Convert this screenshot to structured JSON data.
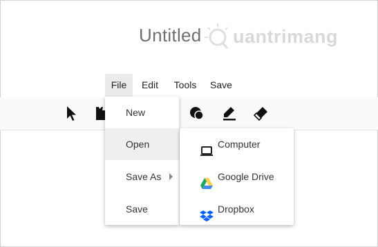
{
  "document": {
    "title": "Untitled"
  },
  "watermark": {
    "text": "uantrimang"
  },
  "menubar": {
    "items": [
      {
        "label": "File"
      },
      {
        "label": "Edit"
      },
      {
        "label": "Tools"
      },
      {
        "label": "Save"
      }
    ]
  },
  "toolbar": {
    "tools": [
      {
        "icon": "cursor-icon"
      },
      {
        "icon": "clapper-icon"
      },
      {
        "icon": "shape-fill-icon"
      },
      {
        "icon": "pen-icon"
      },
      {
        "icon": "eraser-icon"
      }
    ]
  },
  "file_menu": {
    "items": [
      {
        "label": "New"
      },
      {
        "label": "Open"
      },
      {
        "label": "Save As"
      },
      {
        "label": "Save"
      }
    ]
  },
  "open_submenu": {
    "items": [
      {
        "label": "Computer",
        "icon": "laptop-icon"
      },
      {
        "label": "Google Drive",
        "icon": "google-drive-icon"
      },
      {
        "label": "Dropbox",
        "icon": "dropbox-icon"
      }
    ]
  },
  "colors": {
    "drive_green": "#1fa463",
    "drive_yellow": "#ffd04b",
    "drive_blue": "#4688f4",
    "dropbox_blue": "#0061fe"
  }
}
